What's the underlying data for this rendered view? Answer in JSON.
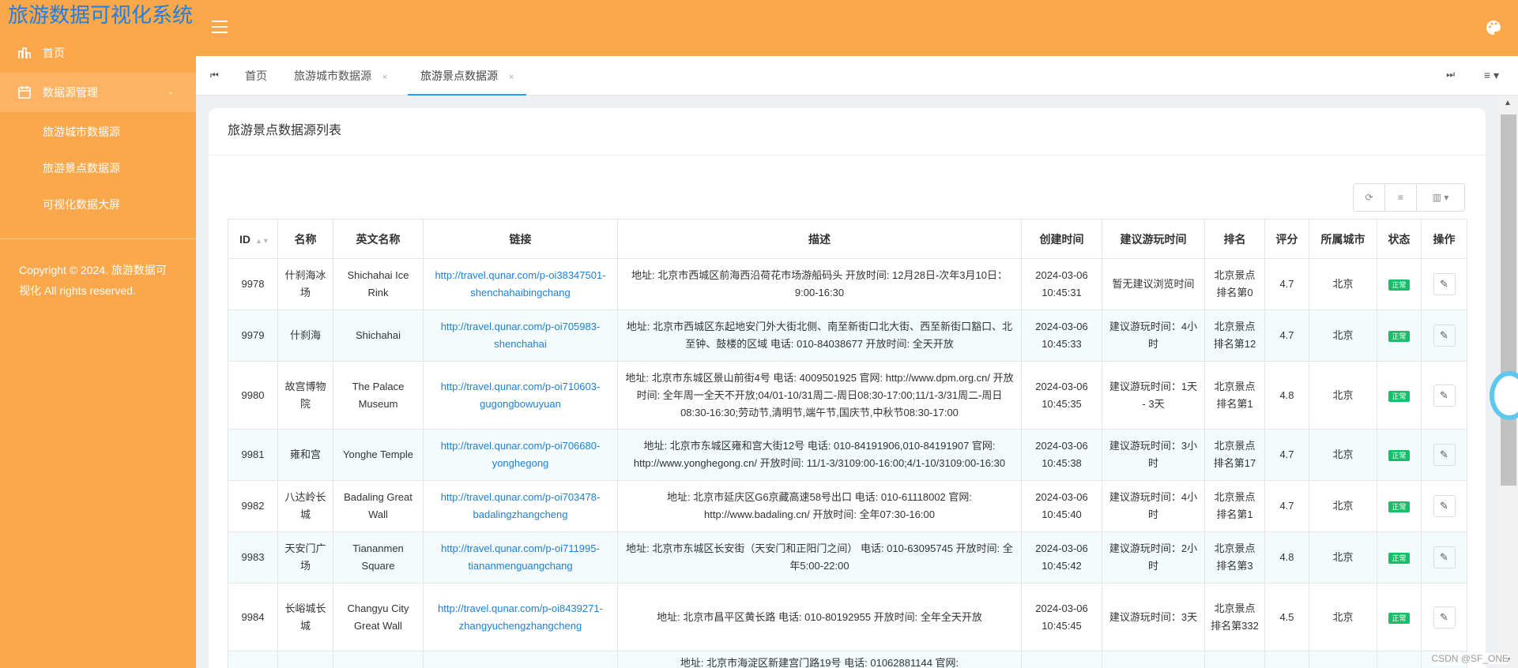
{
  "sidebar": {
    "brand": "旅游数据可视化系统",
    "items": [
      {
        "label": "首页"
      },
      {
        "label": "数据源管理"
      }
    ],
    "sub_items": [
      {
        "label": "旅游城市数据源"
      },
      {
        "label": "旅游景点数据源"
      },
      {
        "label": "可视化数据大屏"
      }
    ],
    "copyright": "Copyright © 2024. 旅游数据可视化 All rights reserved."
  },
  "tabs": [
    {
      "label": "首页",
      "close": ""
    },
    {
      "label": "旅游城市数据源",
      "close": "×"
    },
    {
      "label": "旅游景点数据源",
      "close": "×"
    }
  ],
  "panel": {
    "title": "旅游景点数据源列表"
  },
  "table": {
    "headers": [
      "ID",
      "名称",
      "英文名称",
      "链接",
      "描述",
      "创建时间",
      "建议游玩时间",
      "排名",
      "评分",
      "所属城市",
      "状态",
      "操作"
    ],
    "rows": [
      {
        "id": "9978",
        "name": "什刹海冰场",
        "en": "Shichahai Ice Rink",
        "link": "http://travel.qunar.com/p-oi38347501-shenchahaibingchang",
        "desc": "地址: 北京市西城区前海西沿荷花市场游船码头 开放时间: 12月28日-次年3月10日：9:00-16:30",
        "created": "2024-03-06 10:45:31",
        "duration": "暂无建议浏览时间",
        "rank": "北京景点排名第0",
        "score": "4.7",
        "city": "北京",
        "status": "正常"
      },
      {
        "id": "9979",
        "name": "什刹海",
        "en": "Shichahai",
        "link": "http://travel.qunar.com/p-oi705983-shenchahai",
        "desc": "地址: 北京市西城区东起地安门外大街北侧、南至新街口北大街、西至新街口豁口、北至钟、鼓楼的区域 电话: 010-84038677 开放时间: 全天开放",
        "created": "2024-03-06 10:45:33",
        "duration": "建议游玩时间：4小时",
        "rank": "北京景点排名第12",
        "score": "4.7",
        "city": "北京",
        "status": "正常"
      },
      {
        "id": "9980",
        "name": "故宫博物院",
        "en": "The Palace Museum",
        "link": "http://travel.qunar.com/p-oi710603-gugongbowuyuan",
        "desc": "地址: 北京市东城区景山前街4号 电话: 4009501925 官网: http://www.dpm.org.cn/ 开放时间: 全年周一全天不开放;04/01-10/31周二-周日08:30-17:00;11/1-3/31周二-周日08:30-16:30;劳动节,清明节,端午节,国庆节,中秋节08:30-17:00",
        "created": "2024-03-06 10:45:35",
        "duration": "建议游玩时间：1天 - 3天",
        "rank": "北京景点排名第1",
        "score": "4.8",
        "city": "北京",
        "status": "正常"
      },
      {
        "id": "9981",
        "name": "雍和宫",
        "en": "Yonghe Temple",
        "link": "http://travel.qunar.com/p-oi706680-yonghegong",
        "desc": "地址: 北京市东城区雍和宫大街12号 电话: 010-84191906,010-84191907 官网: http://www.yonghegong.cn/ 开放时间: 11/1-3/3109:00-16:00;4/1-10/3109:00-16:30",
        "created": "2024-03-06 10:45:38",
        "duration": "建议游玩时间：3小时",
        "rank": "北京景点排名第17",
        "score": "4.7",
        "city": "北京",
        "status": "正常"
      },
      {
        "id": "9982",
        "name": "八达岭长城",
        "en": "Badaling Great Wall",
        "link": "http://travel.qunar.com/p-oi703478-badalingzhangcheng",
        "desc": "地址: 北京市延庆区G6京藏高速58号出口 电话: 010-61118002 官网: http://www.badaling.cn/ 开放时间: 全年07:30-16:00",
        "created": "2024-03-06 10:45:40",
        "duration": "建议游玩时间：4小时",
        "rank": "北京景点排名第1",
        "score": "4.7",
        "city": "北京",
        "status": "正常"
      },
      {
        "id": "9983",
        "name": "天安门广场",
        "en": "Tiananmen Square",
        "link": "http://travel.qunar.com/p-oi711995-tiananmenguangchang",
        "desc": "地址: 北京市东城区长安街（天安门和正阳门之间） 电话: 010-63095745 开放时间: 全年5:00-22:00",
        "created": "2024-03-06 10:45:42",
        "duration": "建议游玩时间：2小时",
        "rank": "北京景点排名第3",
        "score": "4.8",
        "city": "北京",
        "status": "正常"
      },
      {
        "id": "9984",
        "name": "长峪城长城",
        "en": "Changyu City Great Wall",
        "link": "http://travel.qunar.com/p-oi8439271-zhangyuchengzhangcheng",
        "desc": "地址: 北京市昌平区黄长路 电话: 010-80192955 开放时间: 全年全天开放",
        "created": "2024-03-06 10:45:45",
        "duration": "建议游玩时间：3天",
        "rank": "北京景点排名第332",
        "score": "4.5",
        "city": "北京",
        "status": "正常"
      },
      {
        "id": "",
        "name": "",
        "en": "",
        "link": "",
        "desc": "地址: 北京市海淀区新建宫门路19号 电话: 01062881144 官网:",
        "created": "",
        "duration": "",
        "rank": "",
        "score": "",
        "city": "",
        "status": ""
      }
    ]
  },
  "watermark": "CSDN @SF_ONE"
}
